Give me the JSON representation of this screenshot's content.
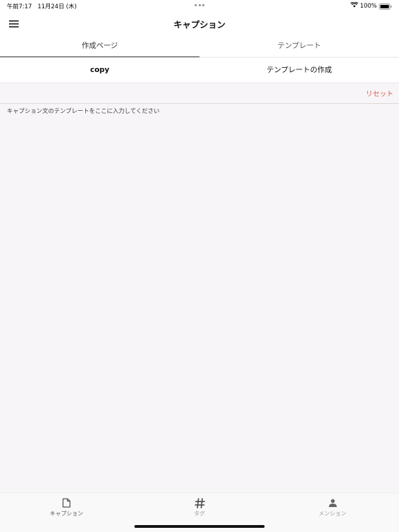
{
  "status_bar": {
    "time": "午前7:17",
    "date": "11月24日 (木)",
    "battery": "100%"
  },
  "nav": {
    "title": "キャプション",
    "menu_icon": "hamburger-menu-icon"
  },
  "top_tabs": [
    {
      "label": "作成ページ",
      "active": true
    },
    {
      "label": "テンプレート",
      "active": false
    }
  ],
  "actions": {
    "copy_label": "copy",
    "create_template_label": "テンプレートの作成"
  },
  "reset_label": "リセット",
  "editor": {
    "placeholder": "キャプション文のテンプレートをここに入力してください",
    "value": ""
  },
  "bottom_tabs": [
    {
      "label": "キャプション",
      "icon": "document-icon",
      "active": true
    },
    {
      "label": "タグ",
      "icon": "hashtag-icon",
      "active": false
    },
    {
      "label": "メンション",
      "icon": "person-icon",
      "active": false
    }
  ],
  "colors": {
    "accent_red": "#e0584a",
    "background": "#f7f5f8"
  }
}
